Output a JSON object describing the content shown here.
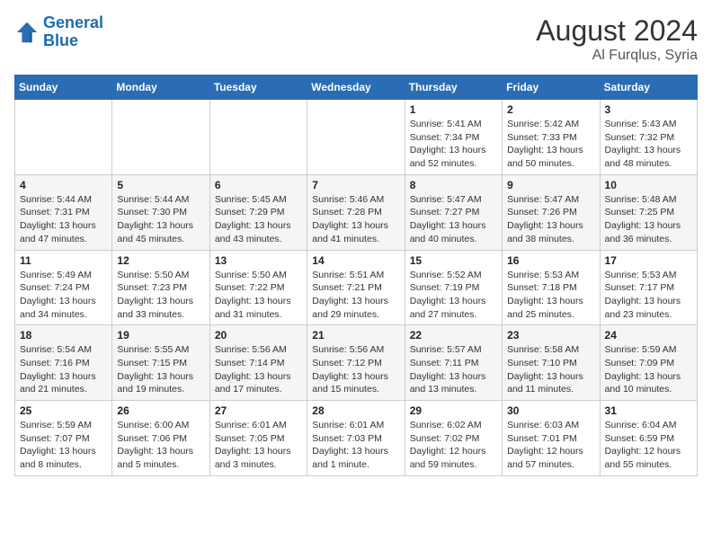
{
  "header": {
    "logo_line1": "General",
    "logo_line2": "Blue",
    "month_year": "August 2024",
    "location": "Al Furqlus, Syria"
  },
  "weekdays": [
    "Sunday",
    "Monday",
    "Tuesday",
    "Wednesday",
    "Thursday",
    "Friday",
    "Saturday"
  ],
  "weeks": [
    [
      {
        "day": "",
        "info": ""
      },
      {
        "day": "",
        "info": ""
      },
      {
        "day": "",
        "info": ""
      },
      {
        "day": "",
        "info": ""
      },
      {
        "day": "1",
        "info": "Sunrise: 5:41 AM\nSunset: 7:34 PM\nDaylight: 13 hours\nand 52 minutes."
      },
      {
        "day": "2",
        "info": "Sunrise: 5:42 AM\nSunset: 7:33 PM\nDaylight: 13 hours\nand 50 minutes."
      },
      {
        "day": "3",
        "info": "Sunrise: 5:43 AM\nSunset: 7:32 PM\nDaylight: 13 hours\nand 48 minutes."
      }
    ],
    [
      {
        "day": "4",
        "info": "Sunrise: 5:44 AM\nSunset: 7:31 PM\nDaylight: 13 hours\nand 47 minutes."
      },
      {
        "day": "5",
        "info": "Sunrise: 5:44 AM\nSunset: 7:30 PM\nDaylight: 13 hours\nand 45 minutes."
      },
      {
        "day": "6",
        "info": "Sunrise: 5:45 AM\nSunset: 7:29 PM\nDaylight: 13 hours\nand 43 minutes."
      },
      {
        "day": "7",
        "info": "Sunrise: 5:46 AM\nSunset: 7:28 PM\nDaylight: 13 hours\nand 41 minutes."
      },
      {
        "day": "8",
        "info": "Sunrise: 5:47 AM\nSunset: 7:27 PM\nDaylight: 13 hours\nand 40 minutes."
      },
      {
        "day": "9",
        "info": "Sunrise: 5:47 AM\nSunset: 7:26 PM\nDaylight: 13 hours\nand 38 minutes."
      },
      {
        "day": "10",
        "info": "Sunrise: 5:48 AM\nSunset: 7:25 PM\nDaylight: 13 hours\nand 36 minutes."
      }
    ],
    [
      {
        "day": "11",
        "info": "Sunrise: 5:49 AM\nSunset: 7:24 PM\nDaylight: 13 hours\nand 34 minutes."
      },
      {
        "day": "12",
        "info": "Sunrise: 5:50 AM\nSunset: 7:23 PM\nDaylight: 13 hours\nand 33 minutes."
      },
      {
        "day": "13",
        "info": "Sunrise: 5:50 AM\nSunset: 7:22 PM\nDaylight: 13 hours\nand 31 minutes."
      },
      {
        "day": "14",
        "info": "Sunrise: 5:51 AM\nSunset: 7:21 PM\nDaylight: 13 hours\nand 29 minutes."
      },
      {
        "day": "15",
        "info": "Sunrise: 5:52 AM\nSunset: 7:19 PM\nDaylight: 13 hours\nand 27 minutes."
      },
      {
        "day": "16",
        "info": "Sunrise: 5:53 AM\nSunset: 7:18 PM\nDaylight: 13 hours\nand 25 minutes."
      },
      {
        "day": "17",
        "info": "Sunrise: 5:53 AM\nSunset: 7:17 PM\nDaylight: 13 hours\nand 23 minutes."
      }
    ],
    [
      {
        "day": "18",
        "info": "Sunrise: 5:54 AM\nSunset: 7:16 PM\nDaylight: 13 hours\nand 21 minutes."
      },
      {
        "day": "19",
        "info": "Sunrise: 5:55 AM\nSunset: 7:15 PM\nDaylight: 13 hours\nand 19 minutes."
      },
      {
        "day": "20",
        "info": "Sunrise: 5:56 AM\nSunset: 7:14 PM\nDaylight: 13 hours\nand 17 minutes."
      },
      {
        "day": "21",
        "info": "Sunrise: 5:56 AM\nSunset: 7:12 PM\nDaylight: 13 hours\nand 15 minutes."
      },
      {
        "day": "22",
        "info": "Sunrise: 5:57 AM\nSunset: 7:11 PM\nDaylight: 13 hours\nand 13 minutes."
      },
      {
        "day": "23",
        "info": "Sunrise: 5:58 AM\nSunset: 7:10 PM\nDaylight: 13 hours\nand 11 minutes."
      },
      {
        "day": "24",
        "info": "Sunrise: 5:59 AM\nSunset: 7:09 PM\nDaylight: 13 hours\nand 10 minutes."
      }
    ],
    [
      {
        "day": "25",
        "info": "Sunrise: 5:59 AM\nSunset: 7:07 PM\nDaylight: 13 hours\nand 8 minutes."
      },
      {
        "day": "26",
        "info": "Sunrise: 6:00 AM\nSunset: 7:06 PM\nDaylight: 13 hours\nand 5 minutes."
      },
      {
        "day": "27",
        "info": "Sunrise: 6:01 AM\nSunset: 7:05 PM\nDaylight: 13 hours\nand 3 minutes."
      },
      {
        "day": "28",
        "info": "Sunrise: 6:01 AM\nSunset: 7:03 PM\nDaylight: 13 hours\nand 1 minute."
      },
      {
        "day": "29",
        "info": "Sunrise: 6:02 AM\nSunset: 7:02 PM\nDaylight: 12 hours\nand 59 minutes."
      },
      {
        "day": "30",
        "info": "Sunrise: 6:03 AM\nSunset: 7:01 PM\nDaylight: 12 hours\nand 57 minutes."
      },
      {
        "day": "31",
        "info": "Sunrise: 6:04 AM\nSunset: 6:59 PM\nDaylight: 12 hours\nand 55 minutes."
      }
    ]
  ]
}
